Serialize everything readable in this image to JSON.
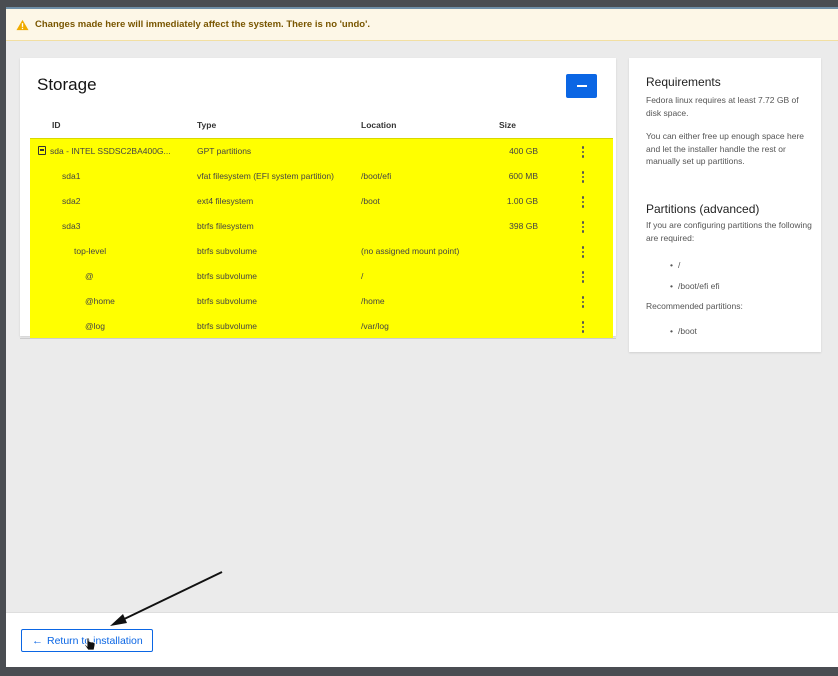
{
  "warning": {
    "text": "Changes made here will immediately affect the system. There is no 'undo'."
  },
  "storage": {
    "title": "Storage",
    "menu_icon": "hamburger-icon",
    "columns": {
      "id": "ID",
      "type": "Type",
      "location": "Location",
      "size": "Size"
    },
    "rows": [
      {
        "id": "sda - INTEL SSDSC2BA400G...",
        "type": "GPT partitions",
        "location": "",
        "size": "400 GB",
        "icon": "disk-icon"
      },
      {
        "id": "sda1",
        "type": "vfat filesystem (EFI system partition)",
        "location": "/boot/efi",
        "size": "600 MB"
      },
      {
        "id": "sda2",
        "type": "ext4 filesystem",
        "location": "/boot",
        "size": "1.00 GB"
      },
      {
        "id": "sda3",
        "type": "btrfs filesystem",
        "location": "",
        "size": "398 GB"
      },
      {
        "id": "top-level",
        "type": "btrfs subvolume",
        "location": "(no assigned mount point)",
        "size": ""
      },
      {
        "id": "@",
        "type": "btrfs subvolume",
        "location": "/",
        "size": ""
      },
      {
        "id": "@home",
        "type": "btrfs subvolume",
        "location": "/home",
        "size": ""
      },
      {
        "id": "@log",
        "type": "btrfs subvolume",
        "location": "/var/log",
        "size": ""
      }
    ],
    "row_highlight_color": "#ffff00"
  },
  "requirements": {
    "title": "Requirements",
    "text1": "Fedora linux requires at least 7.72 GB of disk space.",
    "text2": "You can either free up enough space here and let the installer handle the rest or manually set up partitions.",
    "partitions_title": "Partitions (advanced)",
    "partitions_text": "If you are configuring partitions the following are required:",
    "required": [
      "/",
      "/boot/efi efi"
    ],
    "recommended_label": "Recommended partitions:",
    "recommended": [
      "/boot"
    ]
  },
  "footer": {
    "return_label": "Return to installation",
    "return_icon": "arrow-left-icon"
  },
  "colors": {
    "accent": "#0b66e4",
    "warning_text": "#795600",
    "warning_bg": "#fdf7e7"
  }
}
